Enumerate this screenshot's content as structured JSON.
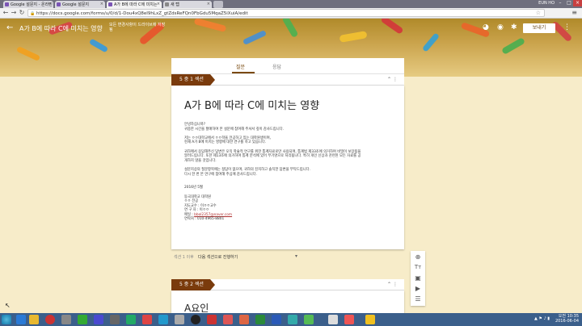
{
  "browser": {
    "tabs": [
      {
        "label": "Google 설문지 - 온라인"
      },
      {
        "label": "Google 설문지"
      },
      {
        "label": "A가 B에 따라 C에 미치는"
      },
      {
        "label": "새 탭"
      }
    ],
    "user_badge": "EUN HO",
    "url": "https://docs.google.com/forms/u/0/d/1-Dou4xQ8eI9hLxZ_gtZdsReFQn0FbGdu5MqaZ5iXuiA/edit"
  },
  "form": {
    "title": "A가 B에 따라 C에 미치는 영향",
    "saved_status": "모든 변경사항이 드라이브에 저장됨",
    "send_label": "보내기",
    "tabs": [
      "질문",
      "응답"
    ],
    "section1_label": "5 중 1 섹션",
    "section1_title": "A가 B에 따라 C에 미치는 영향",
    "description": "안녕하십니까?\n귀중한 시간을 할애하여 본 설문에 참여해 주셔서 깊이 감사드립니다.\n\n저는 ㅇㅇ대학교에서 ㅇㅇ학을 전공하고 있는 대학원생이며,\n현재 A가 B에 미치는 영향에 대한 연구를 하고 있습니다.\n\n귀하께서 응답해주신 답변은 오직 학술적 연구를 위한 통계자료로만 사용되며, 통계법 제33조에 의거하여 비밀이 보장됨을\n알려드립니다. 또한 제13조에 의거하여 통계 분석에 있어 무기명으로 처리됩니다. 특히 개인 신상과 관련된 모든 자료를 공\n개하지 않을 것입니다.\n\n설문지상의 질문항목에는 정답이 없으며, 귀하의 진지하고 솔직한 답변을 부탁드립니다.\n다시 한 번 본 연구에 참여해 주심에 감사드립니다.\n\n\n2016년 5월\n\n동국대학교 대학원\nㅇㅇ 전공\n지도교수 : 이ㅇㅇ교수\n연 구 자 : 이ㅇㅇ\n메일 :",
    "email": "bbol2357@naver.com",
    "phone": "연락처 : 010-4965-8801",
    "after_section_label": "섹션 1 이후",
    "after_section_value": "다음 섹션으로 진행하기",
    "section2_label": "5 중 2 섹션",
    "section2_title": "A요인"
  },
  "sidebar_tools": [
    "add-circle-icon",
    "title-icon",
    "image-icon",
    "video-icon",
    "section-icon"
  ],
  "clock": {
    "time": "오전 10:35",
    "date": "2016-06-04"
  },
  "colors": {
    "accent": "#7a3b0c",
    "banner": "#c9a24a",
    "background": "#f7ecc9"
  }
}
